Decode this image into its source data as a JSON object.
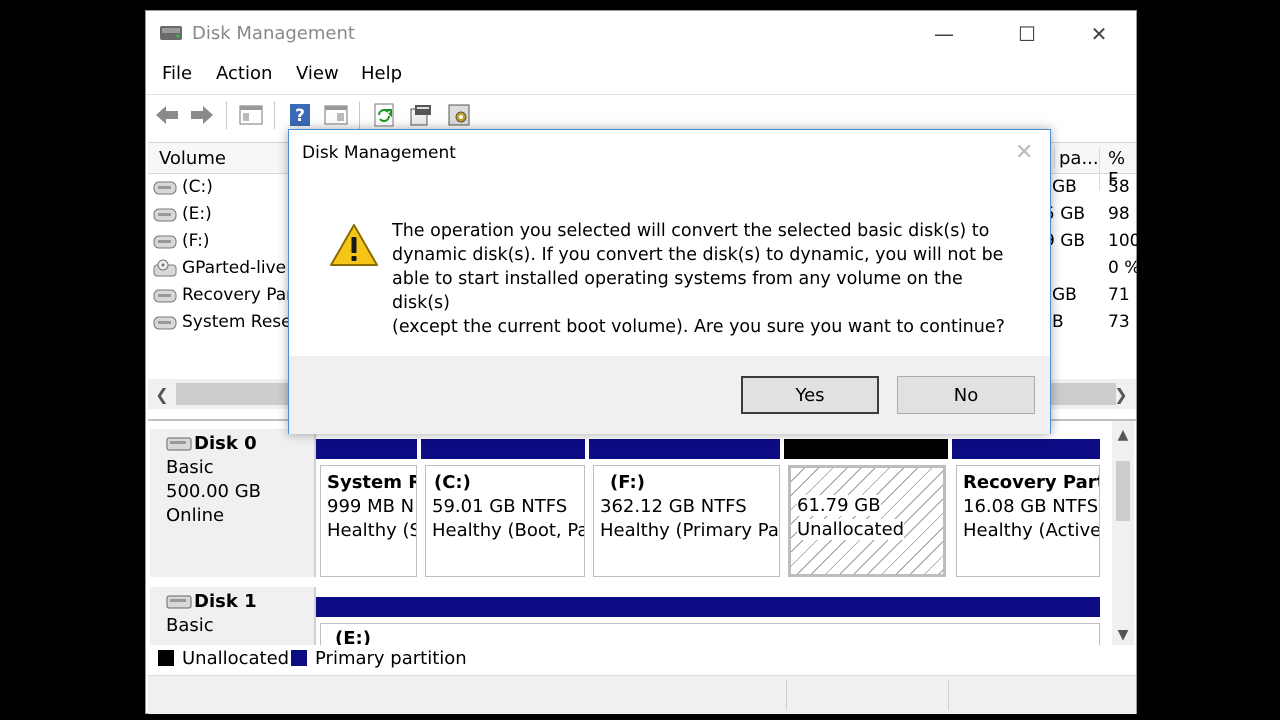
{
  "window": {
    "title": "Disk Management",
    "controls": {
      "minimize": "—",
      "maximize": "☐",
      "close": "✕"
    }
  },
  "menu": [
    "File",
    "Action",
    "View",
    "Help"
  ],
  "toolbar": {
    "icons": [
      "back-arrow-icon",
      "forward-arrow-icon",
      "console-tree-icon",
      "help-icon",
      "properties-icon",
      "refresh-icon",
      "wizard-icon",
      "settings-icon"
    ]
  },
  "volume_list": {
    "headers": {
      "volume": "Volume",
      "capacity": "pa...",
      "percent": "% F"
    },
    "rows": [
      {
        "name": "(C:)",
        "capacity": "GB",
        "percent": "38"
      },
      {
        "name": "(E:)",
        "capacity": "5 GB",
        "percent": "98"
      },
      {
        "name": "(F:)",
        "capacity": "9 GB",
        "percent": "100"
      },
      {
        "name": "GParted-live",
        "capacity": "",
        "percent": "0 %"
      },
      {
        "name": "Recovery Par",
        "capacity": "GB",
        "percent": "71"
      },
      {
        "name": "System Reser",
        "capacity": "B",
        "percent": "73"
      }
    ]
  },
  "disks": [
    {
      "name": "Disk 0",
      "type": "Basic",
      "size": "500.00 GB",
      "status": "Online",
      "partitions": [
        {
          "title": "System R",
          "line2": "999 MB N",
          "line3": "Healthy (S",
          "kind": "primary"
        },
        {
          "title": "(C:)",
          "line2": "59.01 GB NTFS",
          "line3": "Healthy (Boot, Pa",
          "kind": "primary"
        },
        {
          "title": "(F:)",
          "line2": "362.12 GB NTFS",
          "line3": "Healthy (Primary Par",
          "kind": "primary"
        },
        {
          "title": "",
          "line2": "61.79 GB",
          "line3": "Unallocated",
          "kind": "unallocated"
        },
        {
          "title": "Recovery Part",
          "line2": "16.08 GB NTFS",
          "line3": "Healthy (Active",
          "kind": "primary"
        }
      ]
    },
    {
      "name": "Disk 1",
      "type": "Basic",
      "partitions": [
        {
          "title": "(E:)",
          "kind": "primary"
        }
      ]
    }
  ],
  "legend": [
    {
      "label": "Unallocated",
      "color": "#000000"
    },
    {
      "label": "Primary partition",
      "color": "#0c0c84"
    }
  ],
  "colors": {
    "primary": "#0c0c84",
    "unallocated": "#000000",
    "accent": "#4a90d9"
  },
  "dialog": {
    "title": "Disk Management",
    "icon": "warning-icon",
    "message_lines": [
      "The operation you selected will convert the selected basic disk(s) to",
      "dynamic disk(s). If you convert the disk(s) to dynamic, you will not be",
      "able to start installed operating systems from any volume on the disk(s)",
      "(except the current boot volume). Are you sure you want to continue?"
    ],
    "yes_label": "Yes",
    "no_label": "No",
    "close_glyph": "✕"
  }
}
